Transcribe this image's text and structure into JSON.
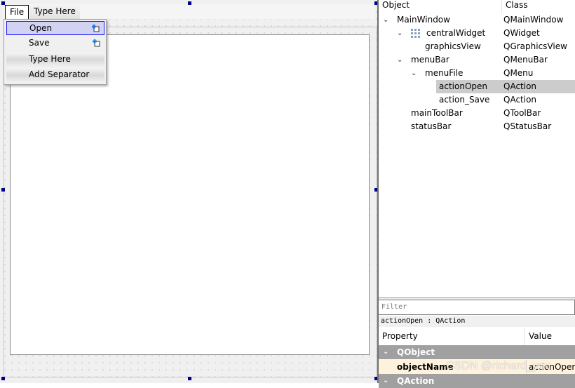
{
  "menubar": {
    "items": [
      "File",
      "Type Here"
    ]
  },
  "file_menu": {
    "items": [
      {
        "label": "Open",
        "selected": true,
        "icon": "add-action-icon"
      },
      {
        "label": "Save",
        "icon": "add-action-icon"
      },
      {
        "label": "Type Here"
      },
      {
        "label": "Add Separator"
      }
    ]
  },
  "object_inspector": {
    "headers": [
      "Object",
      "Class"
    ],
    "rows": [
      {
        "object": "MainWindow",
        "class": "QMainWindow",
        "expanded": true
      },
      {
        "object": "centralWidget",
        "class": "QWidget",
        "expanded": true,
        "icon": "grid-layout-icon"
      },
      {
        "object": "graphicsView",
        "class": "QGraphicsView"
      },
      {
        "object": "menuBar",
        "class": "QMenuBar",
        "expanded": true
      },
      {
        "object": "menuFile",
        "class": "QMenu",
        "expanded": true
      },
      {
        "object": "actionOpen",
        "class": "QAction",
        "selected": true
      },
      {
        "object": "action_Save",
        "class": "QAction"
      },
      {
        "object": "mainToolBar",
        "class": "QToolBar"
      },
      {
        "object": "statusBar",
        "class": "QStatusBar"
      }
    ]
  },
  "property_editor": {
    "filter_placeholder": "Filter",
    "selection": "actionOpen : QAction",
    "headers": [
      "Property",
      "Value"
    ],
    "groups": [
      "QObject",
      "QAction"
    ],
    "object_name": {
      "property": "objectName",
      "value": "actionOpen"
    }
  },
  "watermark": "CSDN @richard_yuu"
}
